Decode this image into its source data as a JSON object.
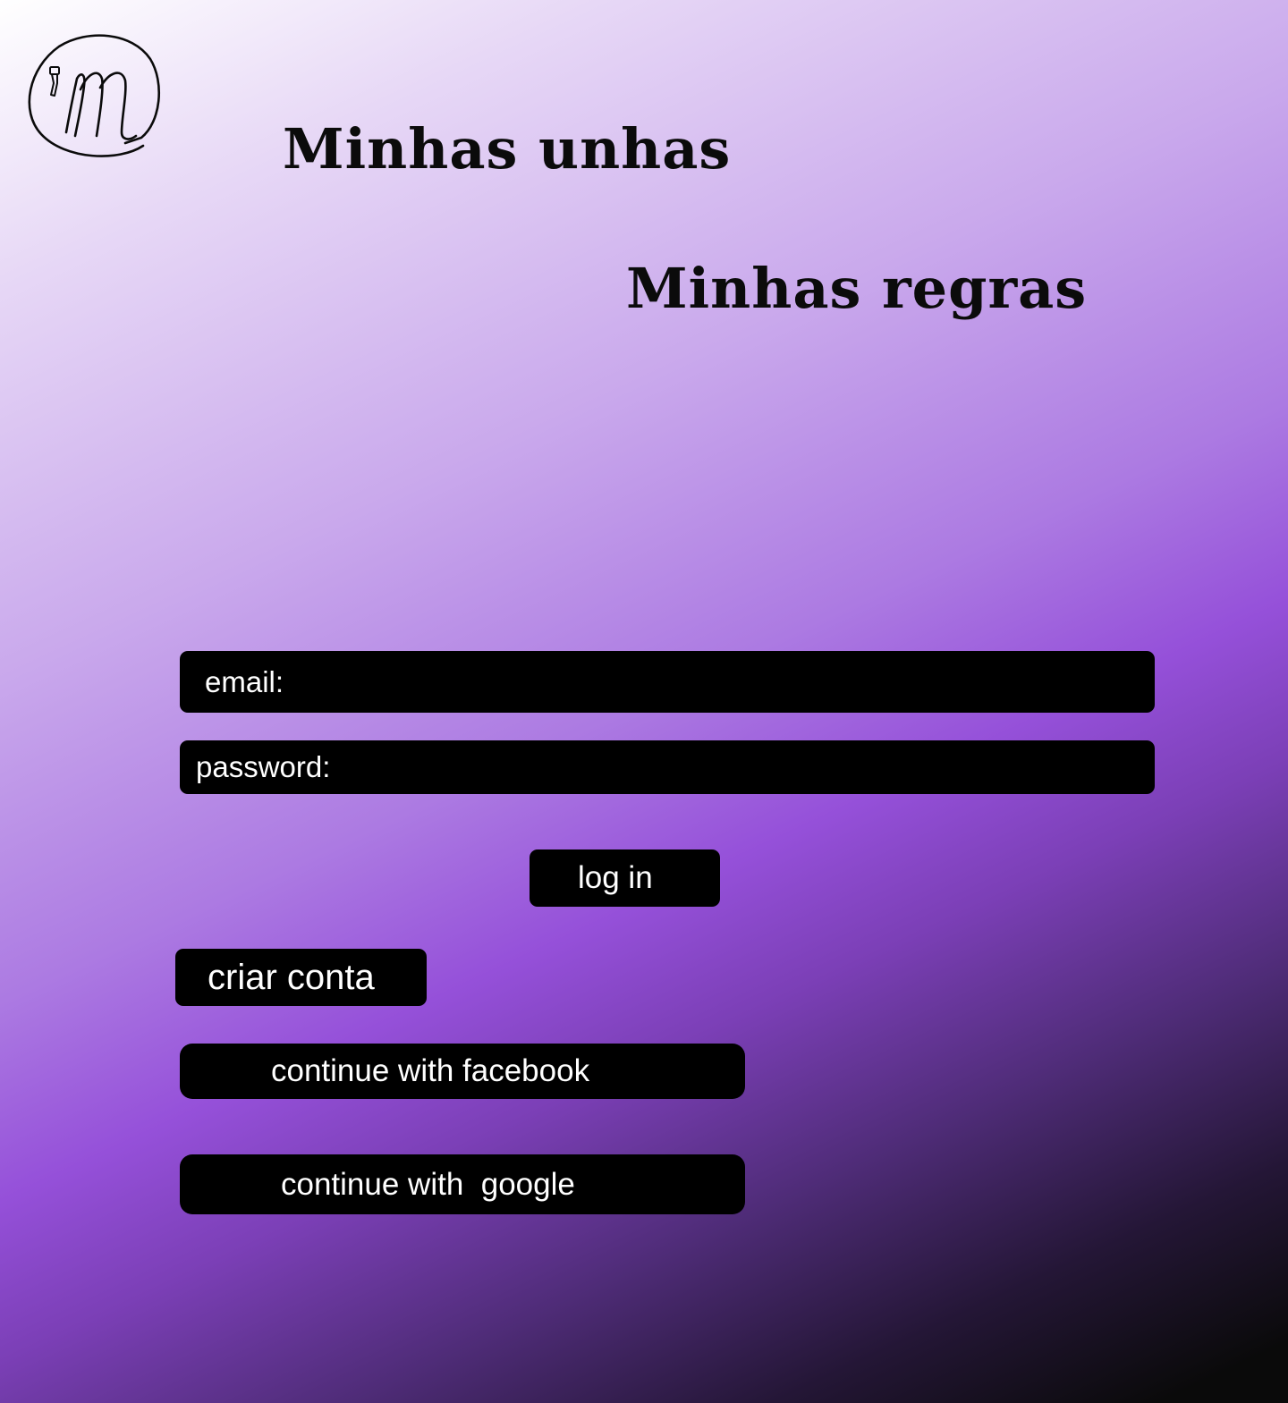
{
  "brand": {
    "logo_icon": "script-m-nail-polish-logo-icon"
  },
  "headings": {
    "title": "Minhas unhas",
    "subtitle": "Minhas regras"
  },
  "form": {
    "email_label": "email:",
    "email_value": "",
    "password_label": "password:",
    "password_value": "",
    "login_label": "log in",
    "create_account_label": "criar conta",
    "facebook_label": "continue with facebook",
    "google_label": "continue with  google"
  },
  "colors": {
    "button_bg": "#000000",
    "button_text": "#ffffff",
    "gradient_start": "#ffffff",
    "gradient_mid": "#9550d9",
    "gradient_end": "#0a0a0a"
  }
}
